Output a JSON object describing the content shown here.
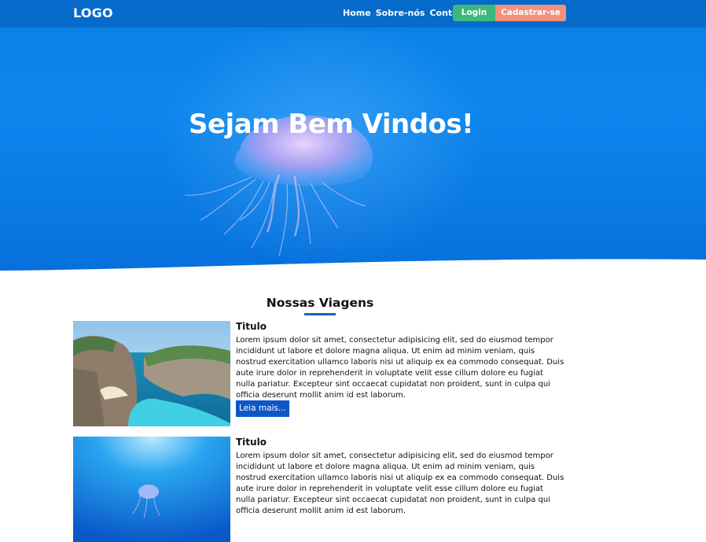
{
  "navbar": {
    "logo": "LOGO",
    "links": [
      "Home",
      "Sobre-nós",
      "Contato"
    ],
    "login_label": "Login",
    "signup_label": "Cadastrar-se"
  },
  "hero": {
    "title": "Sejam Bem Vindos!"
  },
  "section": {
    "title": "Nossas Viagens"
  },
  "cards": [
    {
      "title": "Titulo",
      "text": "Lorem ipsum dolor sit amet, consectetur adipisicing elit, sed do eiusmod tempor incididunt ut labore et dolore magna aliqua. Ut enim ad minim veniam, quis nostrud exercitation ullamco laboris nisi ut aliquip ex ea commodo consequat. Duis aute irure dolor in reprehenderit in voluptate velit esse cillum dolore eu fugiat nulla pariatur. Excepteur sint occaecat cupidatat non proident, sunt in culpa qui officia deserunt mollit anim id est laborum.",
      "button_label": "Leia mais..."
    },
    {
      "title": "Titulo",
      "text": "Lorem ipsum dolor sit amet, consectetur adipisicing elit, sed do eiusmod tempor incididunt ut labore et dolore magna aliqua. Ut enim ad minim veniam, quis nostrud exercitation ullamco laboris nisi ut aliquip ex ea commodo consequat. Duis aute irure dolor in reprehenderit in voluptate velit esse cillum dolore eu fugiat nulla pariatur. Excepteur sint occaecat cupidatat non proident, sunt in culpa qui officia deserunt mollit anim id est laborum."
    }
  ],
  "colors": {
    "hero_blue": "#0a7fe6",
    "login_green": "#3db87a",
    "signup_salmon": "#f2917c",
    "accent_blue": "#0d57c9"
  }
}
